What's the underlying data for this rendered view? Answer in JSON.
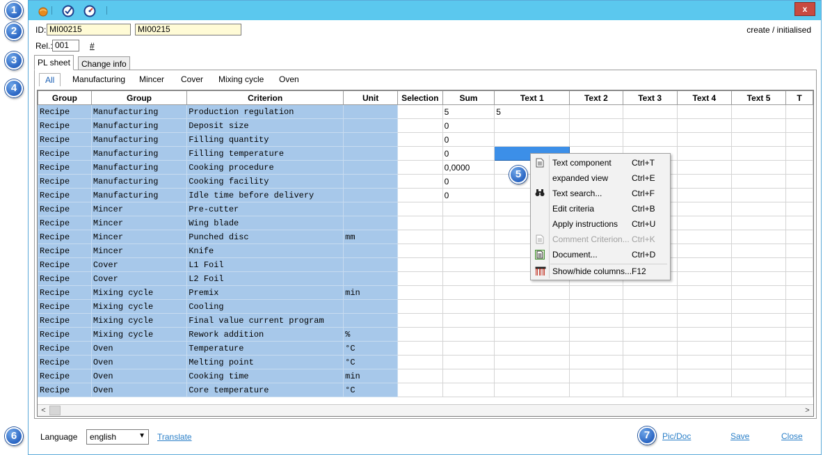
{
  "callouts": [
    "1",
    "2",
    "3",
    "4",
    "5",
    "6",
    "7"
  ],
  "titlebar": {
    "icons": [
      "orange-ball-icon",
      "check-badge-icon",
      "gauge-icon"
    ],
    "close_label": "x"
  },
  "header": {
    "id_label": "ID:",
    "id_value": "MI00215",
    "id_value2": "MI00215",
    "rel_label": "Rel.:",
    "rel_value": "001",
    "hash_label": "#",
    "status": "create / initialised"
  },
  "tabs": [
    {
      "label": "PL sheet",
      "active": true
    },
    {
      "label": "Change info",
      "active": false
    }
  ],
  "subtabs": [
    "All",
    "Manufacturing",
    "Mincer",
    "Cover",
    "Mixing cycle",
    "Oven"
  ],
  "grid": {
    "columns": [
      "Group",
      "Group",
      "Criterion",
      "Unit",
      "Selection",
      "Sum",
      "Text 1",
      "Text 2",
      "Text 3",
      "Text 4",
      "Text 5",
      "T"
    ],
    "rows": [
      {
        "g1": "Recipe",
        "g2": "Manufacturing",
        "crit": "Production regulation",
        "unit": "",
        "sum": "5",
        "t1": "5"
      },
      {
        "g1": "Recipe",
        "g2": "Manufacturing",
        "crit": "Deposit size",
        "unit": "",
        "sum": "0",
        "t1": ""
      },
      {
        "g1": "Recipe",
        "g2": "Manufacturing",
        "crit": "Filling quantity",
        "unit": "",
        "sum": "0",
        "t1": ""
      },
      {
        "g1": "Recipe",
        "g2": "Manufacturing",
        "crit": "Filling temperature",
        "unit": "",
        "sum": "0",
        "t1": ""
      },
      {
        "g1": "Recipe",
        "g2": "Manufacturing",
        "crit": "Cooking procedure",
        "unit": "",
        "sum": "0,0000",
        "t1": ""
      },
      {
        "g1": "Recipe",
        "g2": "Manufacturing",
        "crit": "Cooking facility",
        "unit": "",
        "sum": "0",
        "t1": ""
      },
      {
        "g1": "Recipe",
        "g2": "Manufacturing",
        "crit": "Idle time before delivery",
        "unit": "",
        "sum": "0",
        "t1": ""
      },
      {
        "g1": "Recipe",
        "g2": "Mincer",
        "crit": "Pre-cutter",
        "unit": "",
        "sum": "",
        "t1": ""
      },
      {
        "g1": "Recipe",
        "g2": "Mincer",
        "crit": "Wing blade",
        "unit": "",
        "sum": "",
        "t1": ""
      },
      {
        "g1": "Recipe",
        "g2": "Mincer",
        "crit": "Punched disc",
        "unit": "mm",
        "sum": "",
        "t1": ""
      },
      {
        "g1": "Recipe",
        "g2": "Mincer",
        "crit": "Knife",
        "unit": "",
        "sum": "",
        "t1": ""
      },
      {
        "g1": "Recipe",
        "g2": "Cover",
        "crit": "L1 Foil",
        "unit": "",
        "sum": "",
        "t1": ""
      },
      {
        "g1": "Recipe",
        "g2": "Cover",
        "crit": "L2 Foil",
        "unit": "",
        "sum": "",
        "t1": ""
      },
      {
        "g1": "Recipe",
        "g2": "Mixing cycle",
        "crit": "Premix",
        "unit": "min",
        "sum": "",
        "t1": ""
      },
      {
        "g1": "Recipe",
        "g2": "Mixing cycle",
        "crit": "Cooling",
        "unit": "",
        "sum": "",
        "t1": ""
      },
      {
        "g1": "Recipe",
        "g2": "Mixing cycle",
        "crit": "Final value current program",
        "unit": "",
        "sum": "",
        "t1": ""
      },
      {
        "g1": "Recipe",
        "g2": "Mixing cycle",
        "crit": "Rework addition",
        "unit": "%",
        "sum": "",
        "t1": ""
      },
      {
        "g1": "Recipe",
        "g2": "Oven",
        "crit": "Temperature",
        "unit": "°C",
        "sum": "",
        "t1": ""
      },
      {
        "g1": "Recipe",
        "g2": "Oven",
        "crit": "Melting point",
        "unit": "°C",
        "sum": "",
        "t1": ""
      },
      {
        "g1": "Recipe",
        "g2": "Oven",
        "crit": "Cooking time",
        "unit": "min",
        "sum": "",
        "t1": ""
      },
      {
        "g1": "Recipe",
        "g2": "Oven",
        "crit": "Core temperature",
        "unit": "°C",
        "sum": "",
        "t1": ""
      }
    ],
    "scroll_left": "<",
    "scroll_right": ">"
  },
  "context_menu": {
    "items": [
      {
        "label": "Text component",
        "shortcut": "Ctrl+T",
        "icon": "document-icon",
        "disabled": false
      },
      {
        "label": "expanded view",
        "shortcut": "Ctrl+E",
        "icon": "",
        "disabled": false
      },
      {
        "label": "Text search...",
        "shortcut": "Ctrl+F",
        "icon": "binoculars-icon",
        "disabled": false
      },
      {
        "label": "Edit criteria",
        "shortcut": "Ctrl+B",
        "icon": "",
        "disabled": false
      },
      {
        "label": "Apply instructions",
        "shortcut": "Ctrl+U",
        "icon": "",
        "disabled": false
      },
      {
        "label": "Comment Criterion...",
        "shortcut": "Ctrl+K",
        "icon": "document-icon",
        "disabled": true
      },
      {
        "label": "Document...",
        "shortcut": "Ctrl+D",
        "icon": "green-document-icon",
        "disabled": false
      },
      {
        "label": "Show/hide columns...",
        "shortcut": "F12",
        "icon": "columns-icon",
        "disabled": false
      }
    ]
  },
  "footer": {
    "language_label": "Language",
    "language_value": "english",
    "translate": "Translate",
    "picdoc": "Pic/Doc",
    "save": "Save",
    "close": "Close"
  },
  "colors": {
    "titlebar": "#5bc8ee",
    "fixed_cells": "#a7c8ea",
    "selected_cell": "#3c8fe8",
    "link": "#2a7fc8",
    "callout": "#2b66c3"
  }
}
